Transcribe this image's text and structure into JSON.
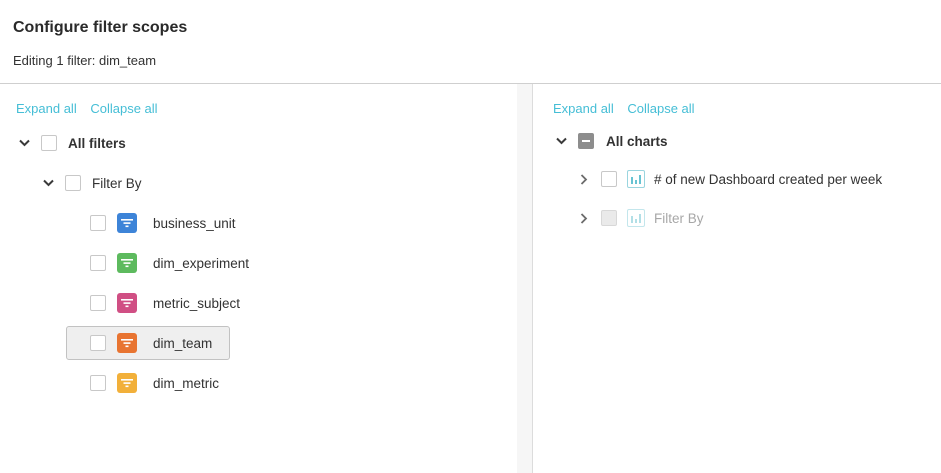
{
  "header": {
    "title": "Configure filter scopes",
    "subtitle": "Editing 1 filter: dim_team"
  },
  "left": {
    "expand_all": "Expand all",
    "collapse_all": "Collapse all",
    "root": {
      "label": "All filters"
    },
    "group": {
      "label": "Filter By"
    },
    "filters": [
      {
        "label": "business_unit",
        "color": "#3d84d8"
      },
      {
        "label": "dim_experiment",
        "color": "#5dba5e"
      },
      {
        "label": "metric_subject",
        "color": "#d04f84"
      },
      {
        "label": "dim_team",
        "color": "#e87431",
        "selected": true
      },
      {
        "label": "dim_metric",
        "color": "#f2b03a"
      }
    ]
  },
  "right": {
    "expand_all": "Expand all",
    "collapse_all": "Collapse all",
    "root": {
      "label": "All charts"
    },
    "charts": [
      {
        "label": "# of new Dashboard created per week"
      },
      {
        "label": "Filter By",
        "disabled": true
      }
    ]
  },
  "colors": {
    "accent": "#45bed6"
  }
}
